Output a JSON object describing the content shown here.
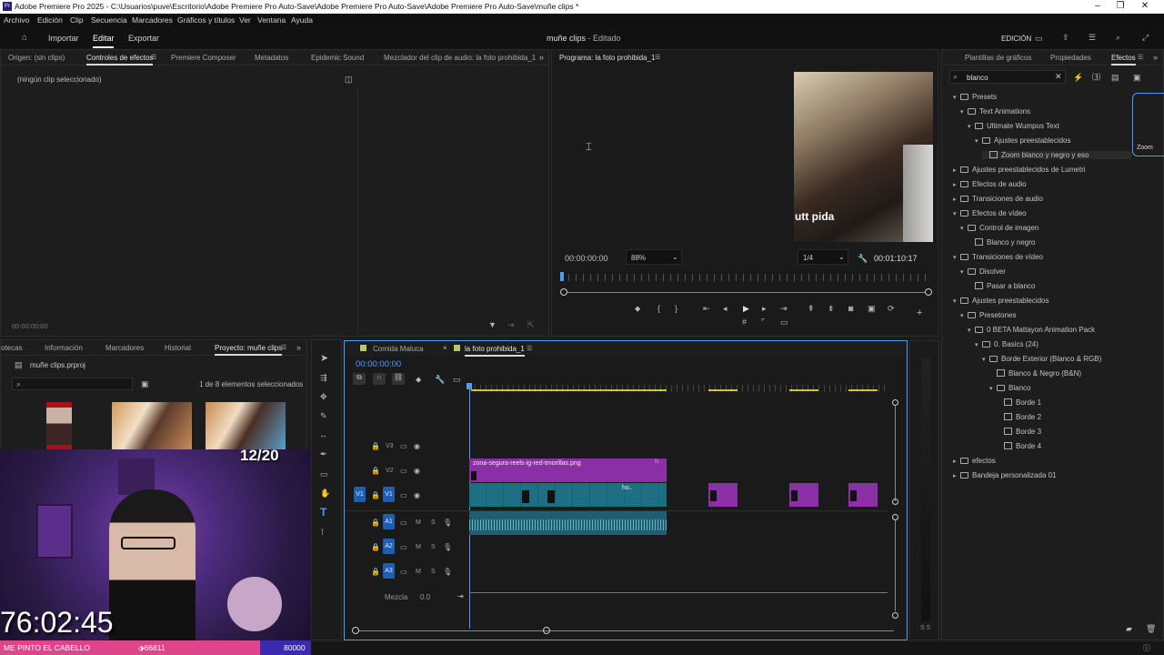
{
  "window": {
    "title": "Adobe Premiere Pro 2025 - C:\\Usuarios\\puve\\Escritorio\\Adobe Premiere Pro Auto-Save\\Adobe Premiere Pro Auto-Save\\Adobe Premiere Pro Auto-Save\\muñe clips *",
    "app_icon": "Pr"
  },
  "menu": [
    "Archivo",
    "Edición",
    "Clip",
    "Secuencia",
    "Marcadores",
    "Gráficos y títulos",
    "Ver",
    "Ventana",
    "Ayuda"
  ],
  "header": {
    "tabs": [
      "Importar",
      "Editar",
      "Exportar"
    ],
    "active_tab": "Editar",
    "project_title": "muñe clips",
    "project_status": " - Editado",
    "workspace_label": "EDICIÓN"
  },
  "source_panel": {
    "tabs": [
      "Origen: (sin clips)",
      "Controles de efectos",
      "Premiere Composer",
      "Metadatos",
      "Epidemic Sound",
      "Mezclador del clip de audio: la foto prohibida_1"
    ],
    "active_tab": "Controles de efectos",
    "empty_message": "(ningún clip seleccionado)",
    "timecode": "00:00:00:00"
  },
  "program_monitor": {
    "title": "Programa: la foto prohibida_1",
    "timecode": "00:00:00:00",
    "zoom": "88%",
    "resolution": "1/4",
    "duration": "00:01:10:17",
    "caption": "utt pida"
  },
  "project_panel": {
    "tabs": [
      "otecas",
      "Información",
      "Marcadores",
      "Historial",
      "Proyecto: muñe clips"
    ],
    "active_tab": "Proyecto: muñe clips",
    "file_name": "muñe clips.prproj",
    "selection_info": "1 de 8 elementos seleccionados"
  },
  "timeline": {
    "tabs": [
      "Comida Maluca",
      "la foto prohibida_1"
    ],
    "active_tab": "la foto prohibida_1",
    "timecode": "00:00:00:00",
    "tracks": [
      {
        "label": "V3",
        "type": "video"
      },
      {
        "label": "V2",
        "type": "video"
      },
      {
        "label": "V1",
        "type": "video",
        "source": "V1"
      },
      {
        "label": "A1",
        "type": "audio"
      },
      {
        "label": "A2",
        "type": "audio"
      },
      {
        "label": "A3",
        "type": "audio"
      }
    ],
    "mix_label": "Mezcla",
    "mix_value": "0.0",
    "audio_m": "M",
    "audio_s": "S",
    "clip_v2": "zona-segura-reels-ig-red-tmorillas.png",
    "clip_v1_text": "ho..",
    "fx_label": "fx"
  },
  "effects_panel": {
    "tabs": [
      "Plantillas de gráficos",
      "Propiedades",
      "Efectos"
    ],
    "active_tab": "Efectos",
    "search_value": "blanco",
    "side_label": "Zoom",
    "tree": [
      {
        "label": "Presets",
        "depth": 0,
        "kind": "folder",
        "open": true
      },
      {
        "label": "Text Animations",
        "depth": 1,
        "kind": "folder",
        "open": true
      },
      {
        "label": "Ultimate Wumpus Text",
        "depth": 2,
        "kind": "folder",
        "open": true
      },
      {
        "label": "Ajustes preestablecidos",
        "depth": 3,
        "kind": "folder",
        "open": true
      },
      {
        "label": "Zoom blanco y negro y eso",
        "depth": 4,
        "kind": "fx",
        "selected": true
      },
      {
        "label": "Ajustes preestablecidos de Lumetri",
        "depth": 0,
        "kind": "folder",
        "open": false
      },
      {
        "label": "Efectos de audio",
        "depth": 0,
        "kind": "folder",
        "open": false
      },
      {
        "label": "Transiciones de audio",
        "depth": 0,
        "kind": "folder",
        "open": false
      },
      {
        "label": "Efectos de vídeo",
        "depth": 0,
        "kind": "folder",
        "open": true
      },
      {
        "label": "Control de imagen",
        "depth": 1,
        "kind": "folder",
        "open": true
      },
      {
        "label": "Blanco y negro",
        "depth": 2,
        "kind": "fx"
      },
      {
        "label": "Transiciones de vídeo",
        "depth": 0,
        "kind": "folder",
        "open": true
      },
      {
        "label": "Disolver",
        "depth": 1,
        "kind": "folder",
        "open": true
      },
      {
        "label": "Pasar a blanco",
        "depth": 2,
        "kind": "fx"
      },
      {
        "label": "Ajustes preestablecidos",
        "depth": 0,
        "kind": "folder",
        "open": true
      },
      {
        "label": "Presetones",
        "depth": 1,
        "kind": "folder",
        "open": true
      },
      {
        "label": "0 BETA Mattayon Animation Pack",
        "depth": 2,
        "kind": "folder",
        "open": true
      },
      {
        "label": "0. Basics (24)",
        "depth": 3,
        "kind": "folder",
        "open": true
      },
      {
        "label": "Borde Exterior (Blanco & RGB)",
        "depth": 4,
        "kind": "folder",
        "open": true
      },
      {
        "label": "Blanco & Negro (B&N)",
        "depth": 5,
        "kind": "fx"
      },
      {
        "label": "Blanco",
        "depth": 5,
        "kind": "folder",
        "open": true
      },
      {
        "label": "Borde 1",
        "depth": 6,
        "kind": "fx"
      },
      {
        "label": "Borde 2",
        "depth": 6,
        "kind": "fx"
      },
      {
        "label": "Borde 3",
        "depth": 6,
        "kind": "fx"
      },
      {
        "label": "Borde 4",
        "depth": 6,
        "kind": "fx"
      },
      {
        "label": "efectos",
        "depth": 0,
        "kind": "folder",
        "open": false
      },
      {
        "label": "Bandeja personalizada 01",
        "depth": 0,
        "kind": "folder",
        "open": false
      }
    ]
  },
  "stream_overlay": {
    "counter": "12/20",
    "timer": "76:02:45",
    "bar_text": "ME PINTO EL CABELLO",
    "bar_count": "66811",
    "bar_goal": "80000"
  },
  "audio_meter": {
    "labels": "S S"
  },
  "colors": {
    "accent": "#4b9cff",
    "clip_purple": "#8a2fa6",
    "clip_teal": "#1f6f84",
    "audio_teal": "#1c5f73",
    "stream_pink": "#e0458c"
  }
}
